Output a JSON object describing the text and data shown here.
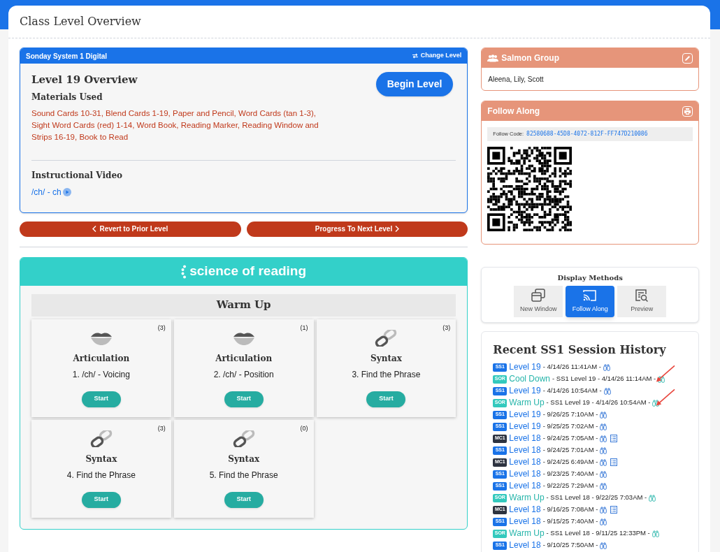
{
  "page": {
    "title": "Class Level Overview"
  },
  "level_card": {
    "program": "Sonday System 1 Digital",
    "change_level": "Change Level",
    "heading": "Level 19 Overview",
    "begin_button": "Begin Level",
    "materials_heading": "Materials Used",
    "materials": "Sound Cards 10-31, Blend Cards 1-19, Paper and Pencil, Word Cards (tan 1-3), Sight Word Cards (red) 1-14, Word Book, Reading Marker, Reading Window and Strips 16-19, Book to Read",
    "video_heading": "Instructional Video",
    "video_link": "/ch/ - ch"
  },
  "nav_buttons": [
    {
      "kind": "prev",
      "label": "Revert to Prior Level"
    },
    {
      "kind": "next",
      "label": "Progress To Next Level"
    }
  ],
  "sor_panel": {
    "logo": "science of reading",
    "section": "Warm Up",
    "activities": [
      {
        "kind": "articulation",
        "category": "Articulation",
        "name": "1. /ch/ - Voicing",
        "count": "(3)",
        "button": "Start"
      },
      {
        "kind": "articulation",
        "category": "Articulation",
        "name": "2. /ch/ - Position",
        "count": "(1)",
        "button": "Start"
      },
      {
        "kind": "syntax",
        "category": "Syntax",
        "name": "3. Find the Phrase",
        "count": "(3)",
        "button": "Start"
      },
      {
        "kind": "syntax",
        "category": "Syntax",
        "name": "4. Find the Phrase",
        "count": "(3)",
        "button": "Start"
      },
      {
        "kind": "syntax",
        "category": "Syntax",
        "name": "5. Find the Phrase",
        "count": "(0)",
        "button": "Start"
      }
    ]
  },
  "group": {
    "name": "Salmon Group",
    "members": "Aleena, Lily, Scott"
  },
  "follow_along": {
    "title": "Follow Along",
    "code_label": "Follow Code:",
    "code": "82580688-45D8-4072-812F-FF747D210086"
  },
  "display_methods": {
    "title": "Display Methods",
    "options": [
      {
        "label": "New Window",
        "selected": false
      },
      {
        "label": "Follow Along",
        "selected": true
      },
      {
        "label": "Preview",
        "selected": false
      }
    ]
  },
  "history": {
    "title": "Recent SS1 Session History",
    "rows": [
      {
        "kind": "ss1",
        "badge": "SS1",
        "title": "Level 19",
        "detail": "- 4/14/26 11:41AM -",
        "report": false,
        "marked": false
      },
      {
        "kind": "sor",
        "badge": "SOR",
        "title": "Cool Down",
        "detail": "- SS1 Level 19 - 4/14/26 11:14AM -",
        "report": false,
        "marked": true
      },
      {
        "kind": "ss1",
        "badge": "SS1",
        "title": "Level 19",
        "detail": "- 4/14/26 10:54AM -",
        "report": false,
        "marked": false
      },
      {
        "kind": "sor",
        "badge": "SOR",
        "title": "Warm Up",
        "detail": "- SS1 Level 19 - 4/14/26 10:54AM -",
        "report": false,
        "marked": true
      },
      {
        "kind": "ss1",
        "badge": "SS1",
        "title": "Level 19",
        "detail": "- 9/26/25 7:10AM -",
        "report": false,
        "marked": false
      },
      {
        "kind": "ss1",
        "badge": "SS1",
        "title": "Level 19",
        "detail": "- 9/25/25 7:02AM -",
        "report": false,
        "marked": false
      },
      {
        "kind": "mc1",
        "badge": "MC1",
        "title": "Level 18",
        "detail": "- 9/24/25 7:05AM -",
        "report": true,
        "marked": false
      },
      {
        "kind": "ss1",
        "badge": "SS1",
        "title": "Level 18",
        "detail": "- 9/24/25 7:01AM -",
        "report": false,
        "marked": false
      },
      {
        "kind": "mc1",
        "badge": "MC1",
        "title": "Level 18",
        "detail": "- 9/24/25 6:49AM -",
        "report": true,
        "marked": false
      },
      {
        "kind": "ss1",
        "badge": "SS1",
        "title": "Level 18",
        "detail": "- 9/23/25 7:40AM -",
        "report": false,
        "marked": false
      },
      {
        "kind": "ss1",
        "badge": "SS1",
        "title": "Level 18",
        "detail": "- 9/22/25 7:29AM -",
        "report": false,
        "marked": false
      },
      {
        "kind": "sor",
        "badge": "SOR",
        "title": "Warm Up",
        "detail": "- SS1 Level 18 - 9/22/25 7:03AM -",
        "report": false,
        "marked": false
      },
      {
        "kind": "mc1",
        "badge": "MC1",
        "title": "Level 18",
        "detail": "- 9/16/25 7:08AM -",
        "report": true,
        "marked": false
      },
      {
        "kind": "ss1",
        "badge": "SS1",
        "title": "Level 18",
        "detail": "- 9/15/25 7:40AM -",
        "report": false,
        "marked": false
      },
      {
        "kind": "sor",
        "badge": "SOR",
        "title": "Warm Up",
        "detail": "- SS1 Level 18 - 9/11/25 12:33PM -",
        "report": false,
        "marked": false
      },
      {
        "kind": "ss1",
        "badge": "SS1",
        "title": "Level 18",
        "detail": "- 9/10/25 7:50AM -",
        "report": false,
        "marked": false
      }
    ]
  }
}
